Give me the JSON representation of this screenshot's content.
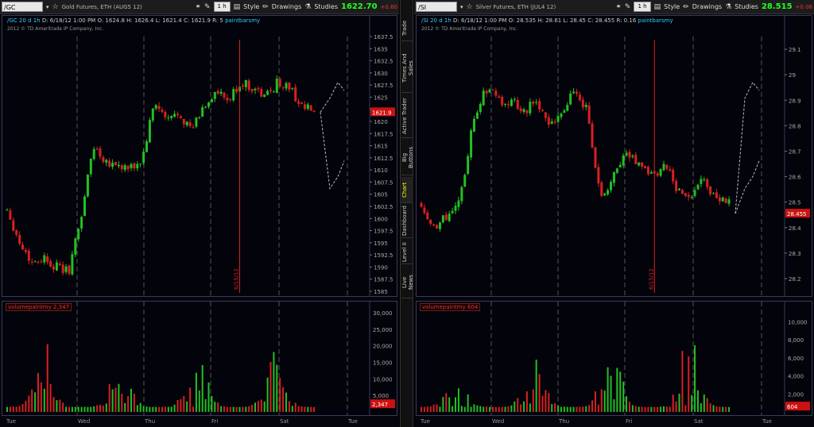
{
  "left": {
    "symbol": "/GC",
    "description": "Gold Futures, ETH (AUG5 12)",
    "aggregation": "1 h",
    "style_label": "Style",
    "drawings_label": "Drawings",
    "studies_label": "Studies",
    "last_price": "1622.70",
    "change": "+0.60",
    "ohlc": {
      "symbol_period": "/GC 20 d 1h",
      "date": "D: 6/18/12 1:00 PM",
      "open": "O: 1624.8",
      "high": "H: 1626.4",
      "low": "L: 1621.4",
      "close": "C: 1621.9",
      "range": "R: 5",
      "study": "paintbarsmy"
    },
    "copyright": "2012 © TD Ameritrade IP Company, Inc.",
    "price_marker": "1621.9",
    "event_label": "6/15/12",
    "volume_header": "volumepaintmy",
    "volume_value": "2,347",
    "volume_marker": "2,347",
    "day_labels": [
      "Tue",
      "Wed",
      "Thu",
      "Fri",
      "Sat",
      "Tue"
    ]
  },
  "right": {
    "symbol": "/SI",
    "description": "Silver Futures, ETH (JUL4 12)",
    "aggregation": "1 h",
    "style_label": "Style",
    "drawings_label": "Drawings",
    "studies_label": "Studies",
    "last_price": "28.515",
    "change": "+0.06",
    "ohlc": {
      "symbol_period": "/SI 20 d 1h",
      "date": "D: 6/18/12 1:00 PM",
      "open": "O: 28.535",
      "high": "H: 28.61",
      "low": "L: 28.45",
      "close": "C: 28.455",
      "range": "R: 0.16",
      "study": "paintbarsmy"
    },
    "copyright": "2012 © TD Ameritrade IP Company, Inc.",
    "price_marker": "28.455",
    "event_label": "6/15/12",
    "volume_header": "volumepaintmy",
    "volume_value": "604",
    "volume_marker": "604",
    "day_labels": [
      "Tue",
      "Wed",
      "Thu",
      "Fri",
      "Sat",
      "Tue"
    ]
  },
  "side_tabs": [
    "Trade",
    "Times And Sales",
    "Active Trader",
    "Big Buttons",
    "Chart",
    "Dashboard",
    "Level II",
    "Live News"
  ],
  "active_tab": "Chart",
  "colors": {
    "up": "#22c022",
    "down": "#d82020",
    "price_marker": "#cc1111",
    "last_up": "#22ff22"
  },
  "chart_data": [
    {
      "type": "candlestick",
      "title": "Gold Futures, ETH (AUG5 12)",
      "interval": "1h",
      "ylim": [
        1585,
        1637.5
      ],
      "y_ticks": [
        "1637.5",
        "1635",
        "1632.5",
        "1630",
        "1627.5",
        "1625",
        "1622.5",
        "1620",
        "1617.5",
        "1615",
        "1612.5",
        "1610",
        "1607.5",
        "1605",
        "1602.5",
        "1600",
        "1597.5",
        "1595",
        "1592.5",
        "1590",
        "1587.5",
        "1585"
      ],
      "x_labels": [
        "Tue",
        "Wed",
        "Thu",
        "Fri",
        "Sat",
        "Tue"
      ],
      "close_path": [
        1602,
        1595,
        1591,
        1592,
        1590,
        1589,
        1600,
        1615,
        1612,
        1611,
        1610,
        1612,
        1624,
        1620,
        1622,
        1618,
        1623,
        1626,
        1624,
        1628,
        1627,
        1625,
        1628,
        1627,
        1623,
        1622
      ],
      "last_close": 1621.9,
      "event_date": "6/15/12",
      "volume": {
        "ylim": [
          0,
          30000
        ],
        "y_ticks": [
          "30,000",
          "25,000",
          "20,000",
          "15,000",
          "10,000",
          "5,000"
        ],
        "last": 2347
      }
    },
    {
      "type": "candlestick",
      "title": "Silver Futures, ETH (JUL4 12)",
      "interval": "1h",
      "ylim": [
        28.15,
        29.15
      ],
      "y_ticks": [
        "29.1",
        "29",
        "28.9",
        "28.8",
        "28.7",
        "28.6",
        "28.5",
        "28.4",
        "28.3",
        "28.2"
      ],
      "x_labels": [
        "Tue",
        "Wed",
        "Thu",
        "Fri",
        "Sat",
        "Tue"
      ],
      "close_path": [
        28.5,
        28.4,
        28.45,
        28.5,
        28.8,
        28.95,
        28.9,
        28.9,
        28.85,
        28.9,
        28.8,
        28.85,
        28.95,
        28.85,
        28.5,
        28.6,
        28.7,
        28.65,
        28.6,
        28.65,
        28.55,
        28.5,
        28.6,
        28.5,
        28.5
      ],
      "last_close": 28.455,
      "event_date": "6/15/12",
      "volume": {
        "ylim": [
          0,
          11000
        ],
        "y_ticks": [
          "10,000",
          "8,000",
          "6,000",
          "4,000",
          "2,000"
        ],
        "last": 604
      }
    }
  ]
}
